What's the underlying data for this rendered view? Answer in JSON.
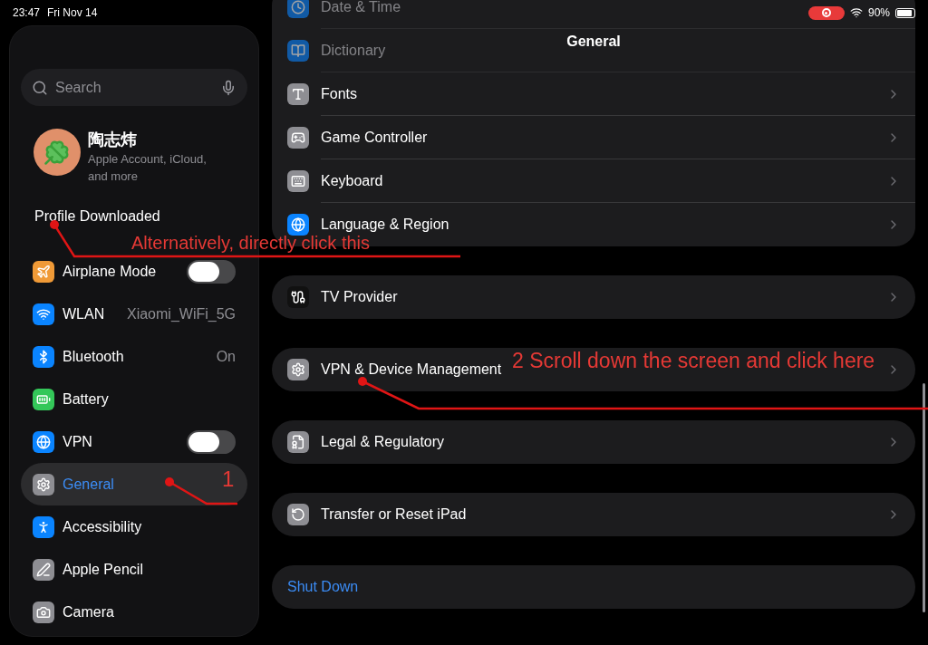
{
  "status_bar": {
    "time": "23:47",
    "date": "Fri Nov 14",
    "battery": "90%"
  },
  "sidebar": {
    "search": {
      "placeholder": "Search"
    },
    "account": {
      "name": "陶志炜",
      "subtitle": "Apple Account, iCloud, and more"
    },
    "notice": "Profile Downloaded",
    "items": [
      {
        "label": "Airplane Mode",
        "kind": "toggle",
        "on": false,
        "selected": false
      },
      {
        "label": "WLAN",
        "kind": "value",
        "value": "Xiaomi_WiFi_5G",
        "selected": false
      },
      {
        "label": "Bluetooth",
        "kind": "value",
        "value": "On",
        "selected": false
      },
      {
        "label": "Battery",
        "kind": "plain",
        "selected": false
      },
      {
        "label": "VPN",
        "kind": "toggle",
        "on": false,
        "selected": false
      },
      {
        "label": "General",
        "kind": "plain",
        "selected": true
      },
      {
        "label": "Accessibility",
        "kind": "plain",
        "selected": false
      },
      {
        "label": "Apple Pencil",
        "kind": "plain",
        "selected": false
      },
      {
        "label": "Camera",
        "kind": "plain",
        "selected": false
      }
    ]
  },
  "detail": {
    "title": "General",
    "groups": [
      {
        "rows": [
          {
            "label": "Date & Time",
            "kind": "link",
            "obscured": true
          },
          {
            "label": "Dictionary",
            "kind": "link",
            "obscured": true
          },
          {
            "label": "Fonts",
            "kind": "link",
            "obscured": false
          },
          {
            "label": "Game Controller",
            "kind": "link",
            "obscured": false
          },
          {
            "label": "Keyboard",
            "kind": "link",
            "obscured": false
          },
          {
            "label": "Language & Region",
            "kind": "link",
            "obscured": false
          }
        ]
      },
      {
        "rows": [
          {
            "label": "TV Provider",
            "kind": "link",
            "obscured": false
          }
        ]
      },
      {
        "rows": [
          {
            "label": "VPN & Device Management",
            "kind": "link",
            "obscured": false
          }
        ]
      },
      {
        "rows": [
          {
            "label": "Legal & Regulatory",
            "kind": "link",
            "obscured": false
          }
        ]
      },
      {
        "rows": [
          {
            "label": "Transfer or Reset iPad",
            "kind": "link",
            "obscured": false
          }
        ]
      },
      {
        "rows": [
          {
            "label": "Shut Down",
            "kind": "action",
            "obscured": false
          }
        ]
      }
    ]
  },
  "annotations": [
    {
      "text": "Alternatively, directly click this"
    },
    {
      "text": "1"
    },
    {
      "text": "2 Scroll down the screen and click here"
    }
  ]
}
